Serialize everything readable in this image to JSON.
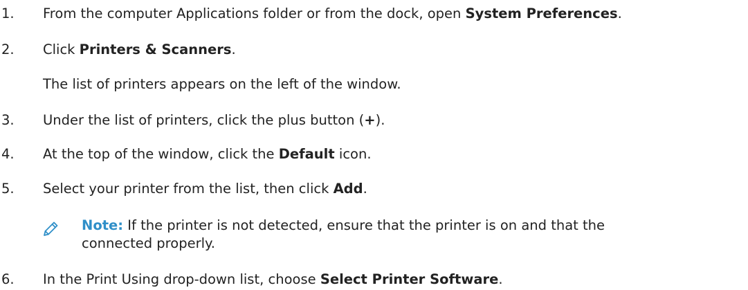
{
  "steps": [
    {
      "num": "1.",
      "before": "From the computer Applications folder or from the dock, open ",
      "bold": "System Preferences",
      "after": "."
    },
    {
      "num": "2.",
      "before": "Click ",
      "bold": "Printers & Scanners",
      "after": "."
    },
    {
      "para": "The list of printers appears on the left of the window."
    },
    {
      "num": "3.",
      "before": "Under the list of printers, click the plus button (",
      "bold": "+",
      "after": ")."
    },
    {
      "num": "4.",
      "before": "At the top of the window, click the ",
      "bold": "Default",
      "after": " icon."
    },
    {
      "num": "5.",
      "before": "Select your printer from the list, then click ",
      "bold": "Add",
      "after": "."
    },
    {
      "num": "6.",
      "before": "In the Print Using drop-down list, choose ",
      "bold": "Select Printer Software",
      "after": "."
    }
  ],
  "note": {
    "label": "Note:",
    "line1": " If the printer is not detected, ensure that the printer is on and that the",
    "line2": "connected properly.",
    "icon": "pencil-icon",
    "color": "#2f8fc8"
  }
}
